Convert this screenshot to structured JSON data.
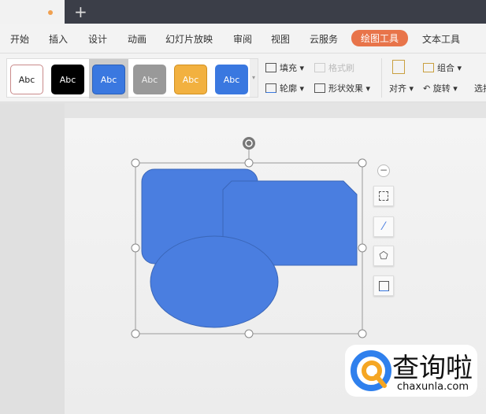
{
  "titlebar": {
    "new_tab": "+"
  },
  "menu": [
    "开始",
    "插入",
    "设计",
    "动画",
    "幻灯片放映",
    "审阅",
    "视图",
    "云服务",
    "绘图工具",
    "文本工具"
  ],
  "active_menu": "绘图工具",
  "ribbon": {
    "styles": [
      "Abc",
      "Abc",
      "Abc",
      "Abc",
      "Abc",
      "Abc"
    ],
    "fill": "填充",
    "format_painter": "格式刷",
    "outline": "轮廓",
    "shape_effects": "形状效果",
    "align": "对齐",
    "group": "组合",
    "rotate": "旋转",
    "select": "选择"
  },
  "colors": {
    "shape": "#4a7ee0",
    "accent": "#e8744a",
    "logo_blue": "#2f80ed",
    "logo_orange": "#f5a623"
  },
  "watermark": {
    "name": "查询啦",
    "url": "chaxunla.com"
  }
}
